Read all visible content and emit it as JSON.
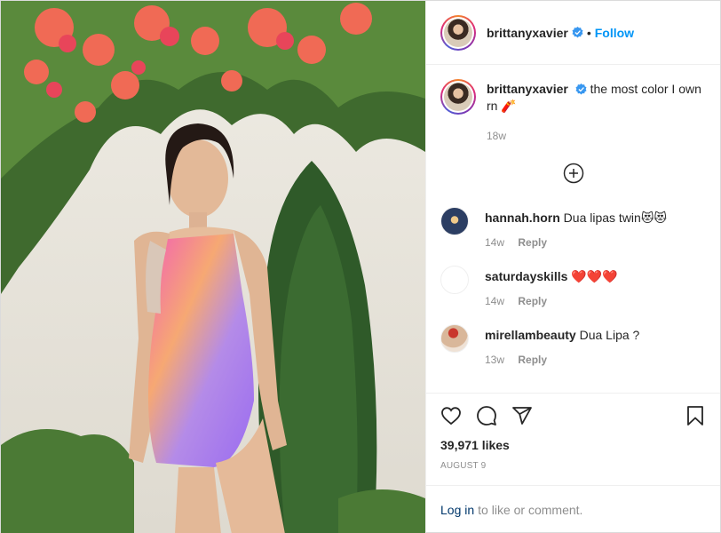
{
  "post": {
    "author": {
      "username": "brittanyxavier",
      "verified": true,
      "separator": "•",
      "follow_label": "Follow"
    },
    "caption": {
      "username": "brittanyxavier",
      "text": "the most color I own rn 🧨",
      "time": "18w"
    },
    "load_more_icon": "plus-circle-icon",
    "comments": [
      {
        "username": "hannah.horn",
        "text": "Dua lipas twin😻😻",
        "time": "14w",
        "reply_label": "Reply",
        "avatar_color": "#2c3e63"
      },
      {
        "username": "saturdayskills",
        "text": "❤️❤️❤️",
        "time": "14w",
        "reply_label": "Reply",
        "avatar_color": "#ffffff"
      },
      {
        "username": "mirellambeauty",
        "text": "Dua Lipa ?",
        "time": "13w",
        "reply_label": "Reply",
        "avatar_color": "#d9b79a"
      }
    ],
    "actions": {
      "icons": [
        "heart-icon",
        "comment-icon",
        "share-icon",
        "bookmark-icon"
      ],
      "likes": "39,971 likes",
      "date": "AUGUST 9"
    },
    "login_prompt": {
      "link": "Log in",
      "text": "to like or comment."
    }
  },
  "colors": {
    "accent": "#0095f6",
    "muted": "#8e8e8e",
    "link": "#00376b"
  }
}
